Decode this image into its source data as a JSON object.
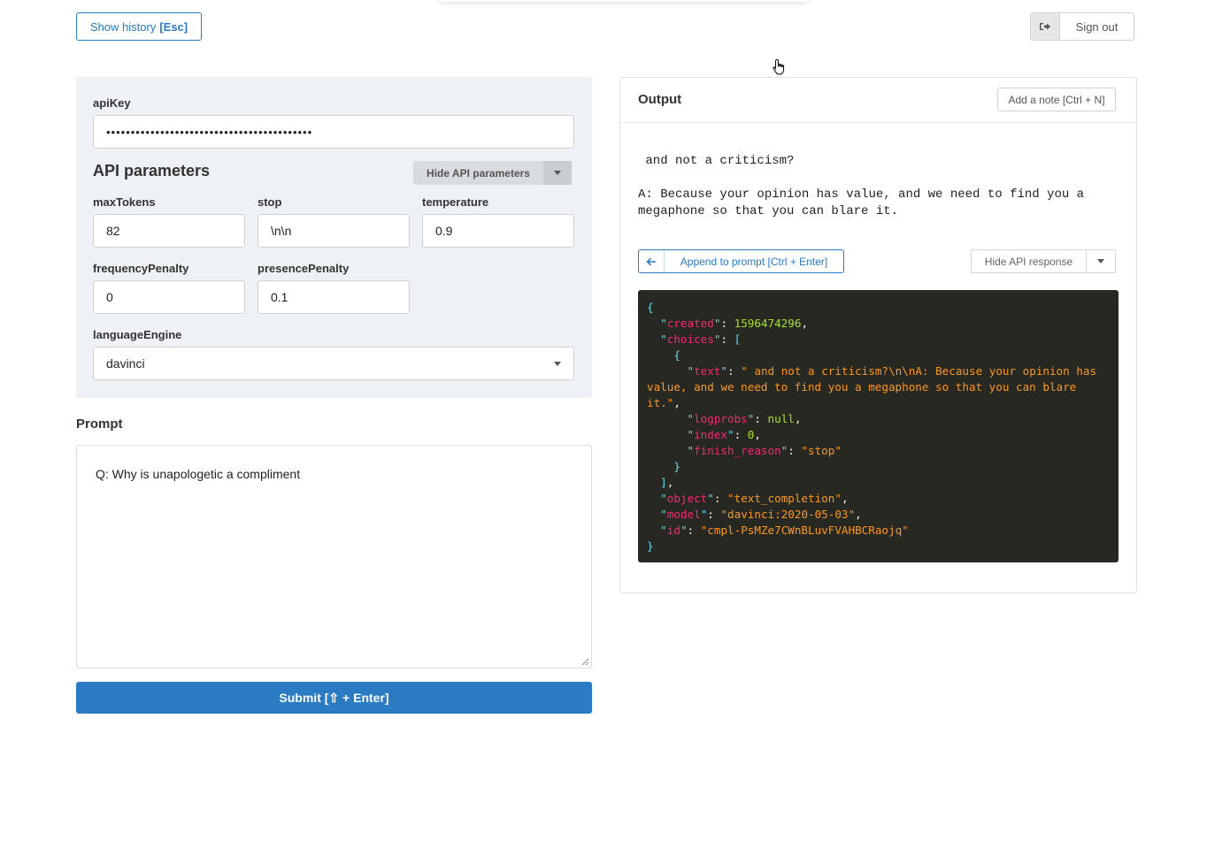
{
  "header": {
    "history_label": "Show history",
    "history_kbd": "[Esc]",
    "signout_label": "Sign out"
  },
  "params": {
    "api_key_label": "apiKey",
    "api_key_value": "••••••••••••••••••••••••••••••••••••••••••",
    "section_title": "API parameters",
    "hide_params_label": "Hide API parameters",
    "fields": {
      "max_tokens": {
        "label": "maxTokens",
        "value": "82"
      },
      "stop": {
        "label": "stop",
        "value": "\\n\\n"
      },
      "temperature": {
        "label": "temperature",
        "value": "0.9"
      },
      "frequency_penalty": {
        "label": "frequencyPenalty",
        "value": "0"
      },
      "presence_penalty": {
        "label": "presencePenalty",
        "value": "0.1"
      },
      "language_engine": {
        "label": "languageEngine",
        "value": "davinci"
      }
    }
  },
  "prompt": {
    "label": "Prompt",
    "value": "Q: Why is unapologetic a compliment",
    "submit_label": "Submit [⇧ + Enter]"
  },
  "output": {
    "title": "Output",
    "add_note_label": "Add a note [Ctrl + N]",
    "completion_line1": " and not a criticism?",
    "completion_line2": "A: Because your opinion has value, and we need to find you a megaphone so that you can blare it.",
    "append_label": "Append to prompt [Ctrl + Enter]",
    "hide_response_label": "Hide API response",
    "json": {
      "created_key": "created",
      "created_val": "1596474296",
      "choices_key": "choices",
      "text_key": "text",
      "text_val": "\" and not a criticism?\\n\\nA: Because your opinion has value, and we need to find you a megaphone so that you can blare it.\"",
      "logprobs_key": "logprobs",
      "logprobs_val": "null",
      "index_key": "index",
      "index_val": "0",
      "finish_key": "finish_reason",
      "finish_val": "\"stop\"",
      "object_key": "object",
      "object_val": "\"text_completion\"",
      "model_key": "model",
      "model_val": "\"davinci:2020-05-03\"",
      "id_key": "id",
      "id_val": "\"cmpl-PsMZe7CWnBLuvFVAHBCRaojq\""
    }
  },
  "icons": {
    "signout": "sign-out-icon",
    "append": "arrow-left-icon",
    "cursor": "hand-cursor-icon"
  },
  "colors": {
    "primary": "#2a7ac4",
    "panel_bg": "#eef1f6",
    "json_bg": "#272822"
  }
}
